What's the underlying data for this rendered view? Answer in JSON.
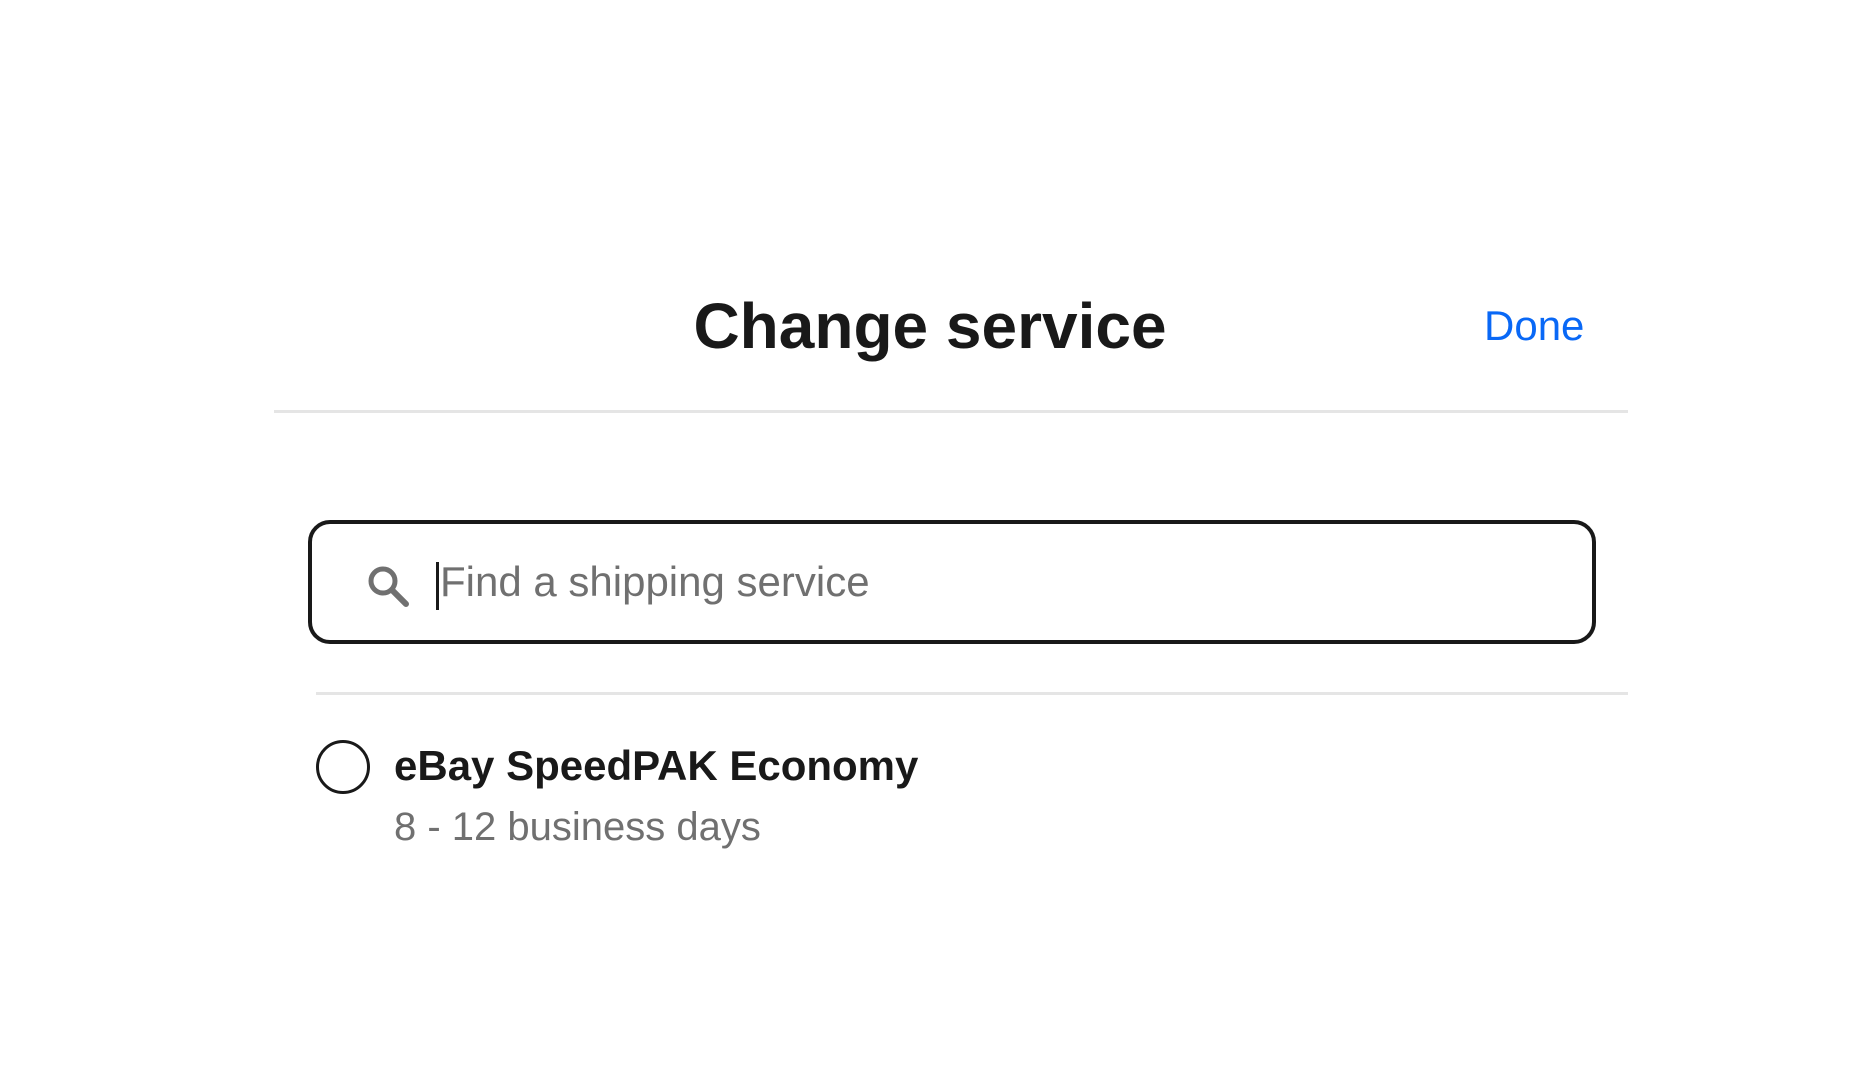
{
  "dialog": {
    "title": "Change service",
    "done_label": "Done",
    "accent_color": "#0968f6"
  },
  "search": {
    "placeholder": "Find a shipping service",
    "value": "",
    "icon": "search-icon"
  },
  "services": [
    {
      "name": "eBay SpeedPAK Economy",
      "eta": "8 - 12 business days",
      "selected": false
    }
  ]
}
